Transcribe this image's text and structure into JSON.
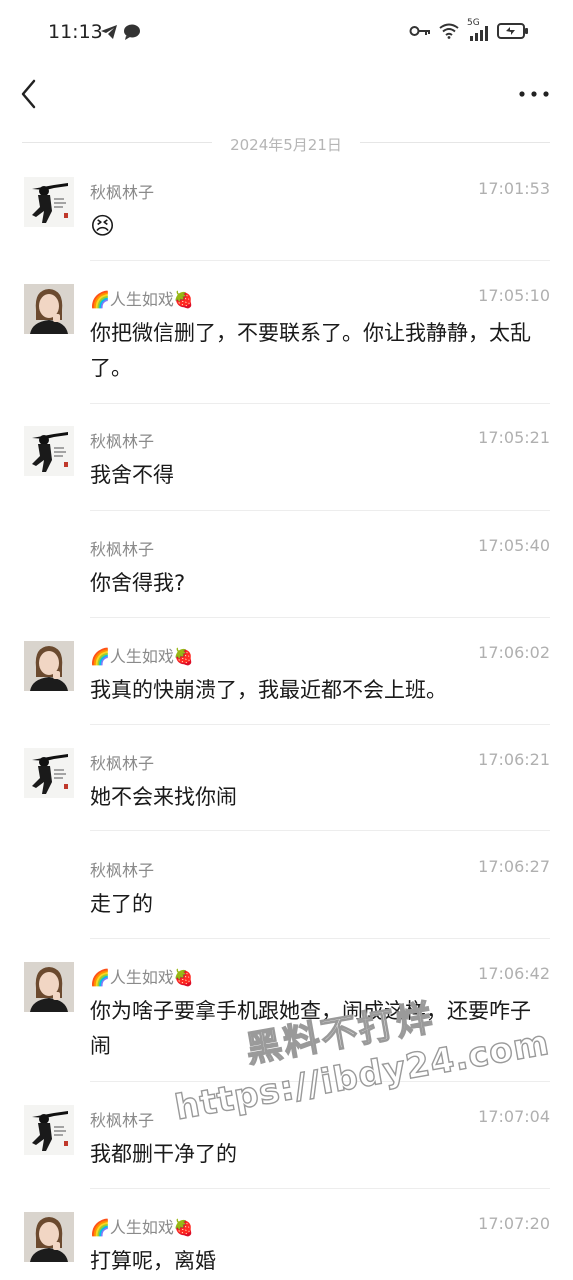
{
  "status_bar": {
    "time": "11:13",
    "network_label": "5G",
    "left_icons": [
      "telegram-icon",
      "chat-bubble-icon"
    ],
    "right_icons": [
      "key-icon",
      "wifi-icon",
      "signal-icon",
      "battery-icon"
    ]
  },
  "header": {
    "back_icon": "chevron-left-icon",
    "more_icon": "more-dots-icon"
  },
  "date_separator": "2024年5月21日",
  "messages": [
    {
      "sender": "秋枫林子",
      "time": "17:01:53",
      "content": "😣",
      "avatar": "avatar-male"
    },
    {
      "sender": "🌈人生如戏🍓",
      "time": "17:05:10",
      "content": "你把微信删了，不要联系了。你让我静静，太乱了。",
      "avatar": "avatar-female"
    },
    {
      "sender": "秋枫林子",
      "time": "17:05:21",
      "content": "我舍不得",
      "avatar": "avatar-male"
    },
    {
      "sender": "秋枫林子",
      "time": "17:05:40",
      "content": "你舍得我?",
      "avatar": ""
    },
    {
      "sender": "🌈人生如戏🍓",
      "time": "17:06:02",
      "content": "我真的快崩溃了，我最近都不会上班。",
      "avatar": "avatar-female"
    },
    {
      "sender": "秋枫林子",
      "time": "17:06:21",
      "content": "她不会来找你闹",
      "avatar": "avatar-male"
    },
    {
      "sender": "秋枫林子",
      "time": "17:06:27",
      "content": "走了的",
      "avatar": ""
    },
    {
      "sender": "🌈人生如戏🍓",
      "time": "17:06:42",
      "content": "你为啥子要拿手机跟她查，闹成这样，还要咋子闹",
      "avatar": "avatar-female"
    },
    {
      "sender": "秋枫林子",
      "time": "17:07:04",
      "content": "我都删干净了的",
      "avatar": "avatar-male"
    },
    {
      "sender": "🌈人生如戏🍓",
      "time": "17:07:20",
      "content": "打算呢，离婚",
      "avatar": "avatar-female"
    }
  ],
  "watermark": {
    "line1": "黑料不打烊",
    "line2": "https://ibdy24.com"
  }
}
